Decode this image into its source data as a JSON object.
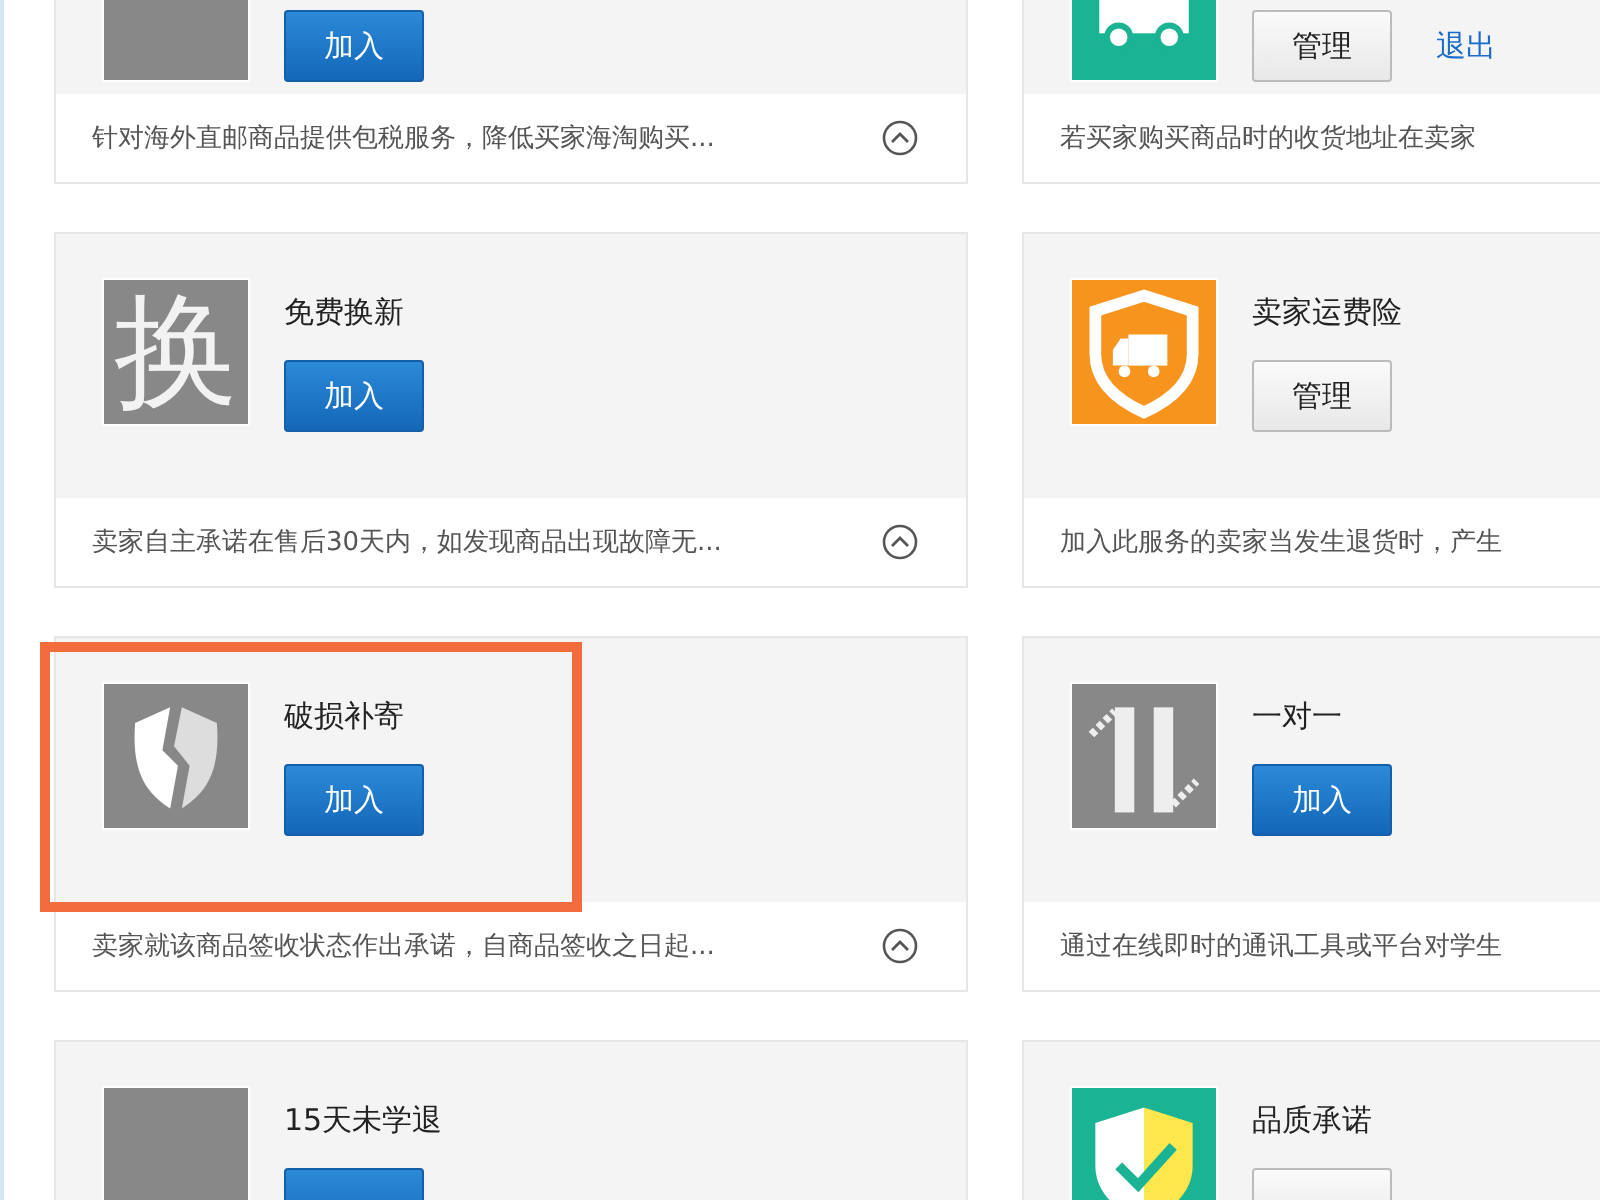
{
  "cards": [
    {
      "icon": {
        "kind": "plain"
      },
      "buttons": [
        {
          "label": "加入",
          "kind": "primary"
        }
      ],
      "description": "针对海外直邮商品提供包税服务，降低买家海淘购买...",
      "toggle": true,
      "highlighted": false,
      "cropped_top": true
    },
    {
      "icon": {
        "kind": "truck-green"
      },
      "buttons": [
        {
          "label": "管理",
          "kind": "secondary"
        },
        {
          "label": "退出",
          "kind": "link"
        }
      ],
      "description": "若买家购买商品时的收货地址在卖家",
      "toggle": false,
      "highlighted": false,
      "cropped_top": true
    },
    {
      "title": "免费换新",
      "icon": {
        "kind": "char",
        "char": "换"
      },
      "buttons": [
        {
          "label": "加入",
          "kind": "primary"
        }
      ],
      "description": "卖家自主承诺在售后30天内，如发现商品出现故障无...",
      "toggle": true,
      "highlighted": false,
      "cropped_top": false
    },
    {
      "title": "卖家运费险",
      "icon": {
        "kind": "shield-truck"
      },
      "buttons": [
        {
          "label": "管理",
          "kind": "secondary"
        }
      ],
      "description": "加入此服务的卖家当发生退货时，产生",
      "toggle": false,
      "highlighted": false,
      "cropped_top": false
    },
    {
      "title": "破损补寄",
      "icon": {
        "kind": "broken-shield"
      },
      "buttons": [
        {
          "label": "加入",
          "kind": "primary"
        }
      ],
      "description": "卖家就该商品签收状态作出承诺，自商品签收之日起...",
      "toggle": true,
      "highlighted": true,
      "cropped_top": false
    },
    {
      "title": "一对一",
      "icon": {
        "kind": "one-on-one"
      },
      "buttons": [
        {
          "label": "加入",
          "kind": "primary"
        }
      ],
      "description": "通过在线即时的通讯工具或平台对学生",
      "toggle": false,
      "highlighted": false,
      "cropped_top": false
    },
    {
      "title": "15天未学退",
      "icon": {
        "kind": "plain"
      },
      "buttons": [
        {
          "kind": "primary"
        }
      ],
      "toggle": false,
      "highlighted": false,
      "cropped_top": false
    },
    {
      "title": "品质承诺",
      "icon": {
        "kind": "check-shield"
      },
      "buttons": [
        {
          "kind": "secondary"
        }
      ],
      "toggle": false,
      "highlighted": false,
      "cropped_top": false
    }
  ]
}
